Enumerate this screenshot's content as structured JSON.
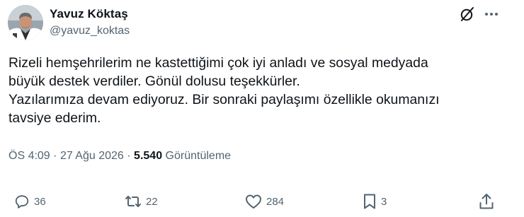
{
  "author": {
    "name": "Yavuz Köktaş",
    "handle": "@yavuz_koktas"
  },
  "post": {
    "lines": [
      "Rizeli hemşehrilerim ne kastettiğimi çok iyi anladı ve sosyal medyada",
      "büyük destek verdiler. Gönül dolusu teşekkürler.",
      "Yazılarımıza devam ediyoruz. Bir sonraki paylaşımı özellikle okumanızı",
      "tavsiye ederim."
    ],
    "time": "ÖS 4:09",
    "separator": "·",
    "date": "27 Ağu 2026",
    "views_count": "5.540",
    "views_label": "Görüntüleme"
  },
  "actions": {
    "replies": "36",
    "reposts": "22",
    "likes": "284",
    "bookmarks": "3"
  },
  "icons": {
    "top_right": [
      "grok-icon",
      "more-icon"
    ],
    "actions": [
      "reply-icon",
      "repost-icon",
      "like-icon",
      "bookmark-icon",
      "share-icon"
    ]
  },
  "colors": {
    "text": "#0f1419",
    "secondary": "#536471"
  }
}
